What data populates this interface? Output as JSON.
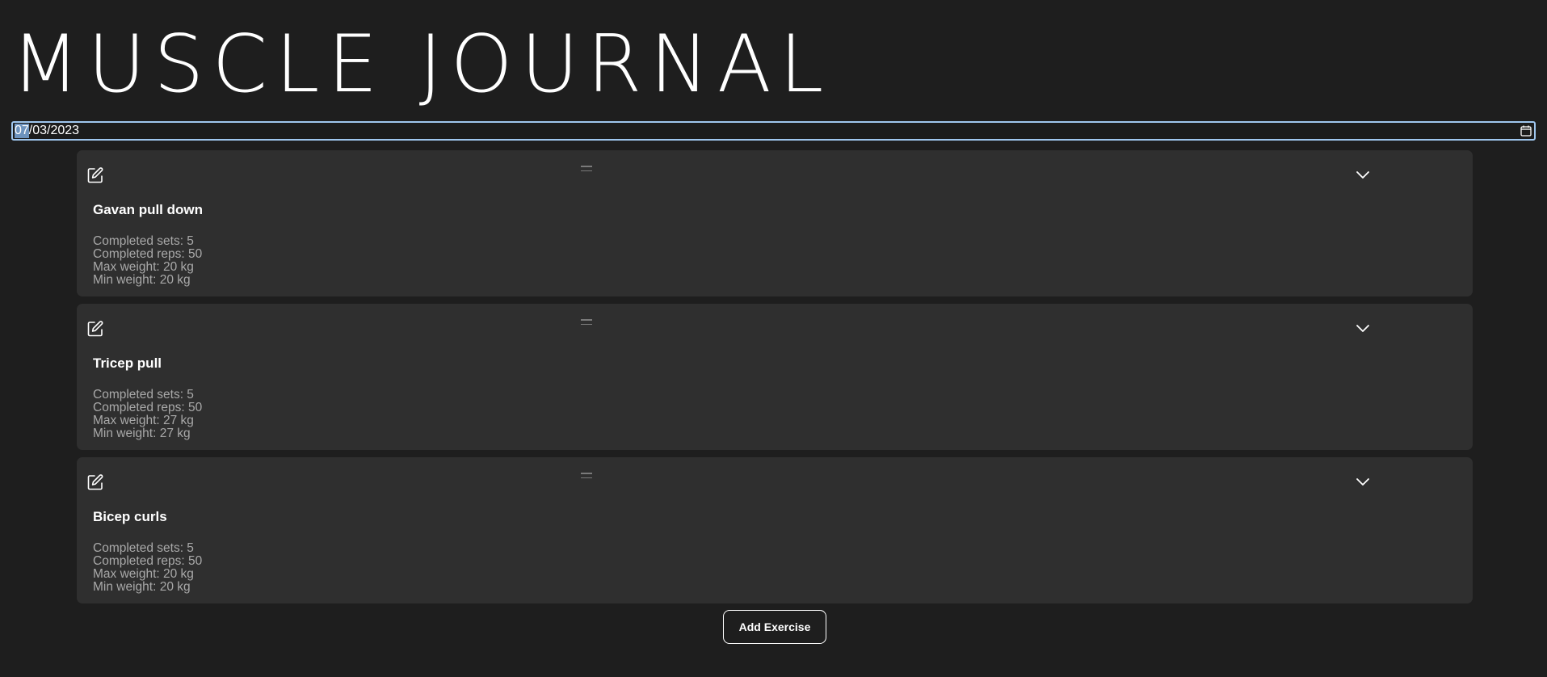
{
  "app": {
    "title": "MUSCLE JOURNAL"
  },
  "date_picker": {
    "month": "07",
    "rest": "/03/2023",
    "selected_segment": "month",
    "icon": "calendar-icon"
  },
  "exercises": [
    {
      "name": "Gavan pull down",
      "sets": "Completed sets: 5",
      "reps": "Completed reps: 50",
      "max_weight": "Max weight: 20 kg",
      "min_weight": "Min weight: 20 kg"
    },
    {
      "name": "Tricep pull",
      "sets": "Completed sets: 5",
      "reps": "Completed reps: 50",
      "max_weight": "Max weight: 27 kg",
      "min_weight": "Min weight: 27 kg"
    },
    {
      "name": "Bicep curls",
      "sets": "Completed sets: 5",
      "reps": "Completed reps: 50",
      "max_weight": "Max weight: 20 kg",
      "min_weight": "Min weight: 20 kg"
    }
  ],
  "card_icons": {
    "edit": "edit-icon",
    "drag": "drag-handle-icon",
    "expand": "chevron-down-icon"
  },
  "actions": {
    "add_exercise_label": "Add Exercise"
  },
  "colors": {
    "background": "#1e1e1e",
    "card": "#2f2f2f",
    "input_focus_border": "#9fc6ee",
    "selection": "#6d93be",
    "secondary_text": "#a9a9a9"
  }
}
